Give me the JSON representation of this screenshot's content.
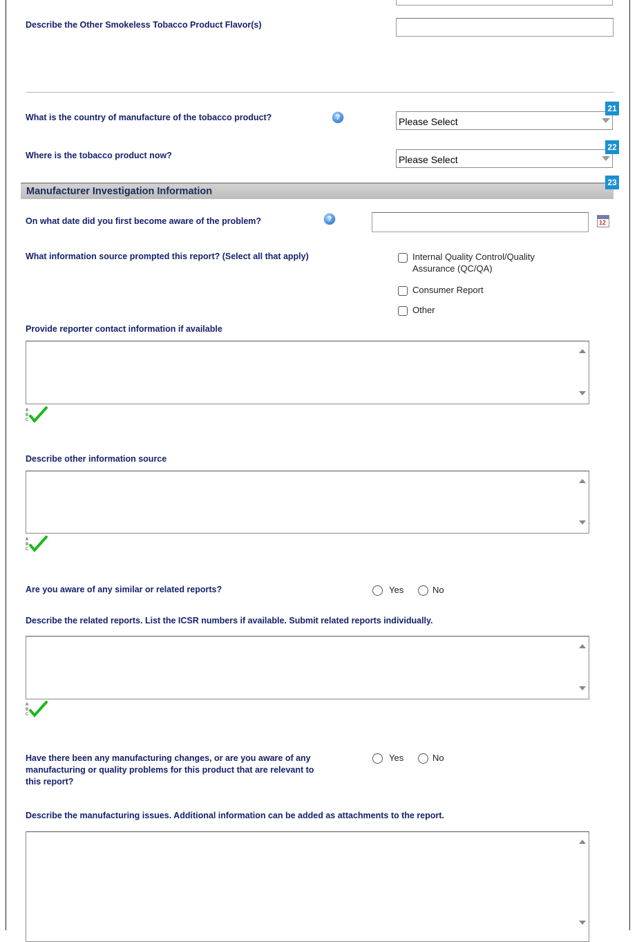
{
  "flavor_question": "Describe the Other Smokeless Tobacco Product Flavor(s)",
  "country_question": "What is the country of manufacture of the tobacco product?",
  "country_select_value": "Please Select",
  "country_badge": "21",
  "location_question": "Where is the tobacco product now?",
  "location_select_value": "Please Select",
  "location_badge": "22",
  "section_title": "Manufacturer Investigation Information",
  "section_badge": "23",
  "aware_date_question": "On what date did you first become aware of the problem?",
  "info_source_question": "What information source prompted this report? (Select all that apply)",
  "info_source_options": [
    "Internal Quality Control/Quality Assurance (QC/QA)",
    "Consumer Report",
    "Other"
  ],
  "reporter_contact_label": "Provide reporter contact information if available",
  "other_source_label": "Describe other information source",
  "similar_reports_question": "Are you aware of any similar or related reports?",
  "yes_label": "Yes",
  "no_label": "No",
  "related_reports_label": "Describe the related reports. List the ICSR numbers if available. Submit related reports individually.",
  "manufacturing_changes_question": "Have there been any manufacturing changes, or are you aware of any manufacturing or quality problems for this product that are relevant to this report?",
  "manufacturing_issues_label": "Describe the manufacturing issues. Additional information can be added as attachments to the report.",
  "calendar_day": "12",
  "colors": {
    "question_text": "#16226b",
    "badge": "#1a8fd1",
    "section_bg": "#c8c8c8",
    "check": "#1db81d"
  }
}
